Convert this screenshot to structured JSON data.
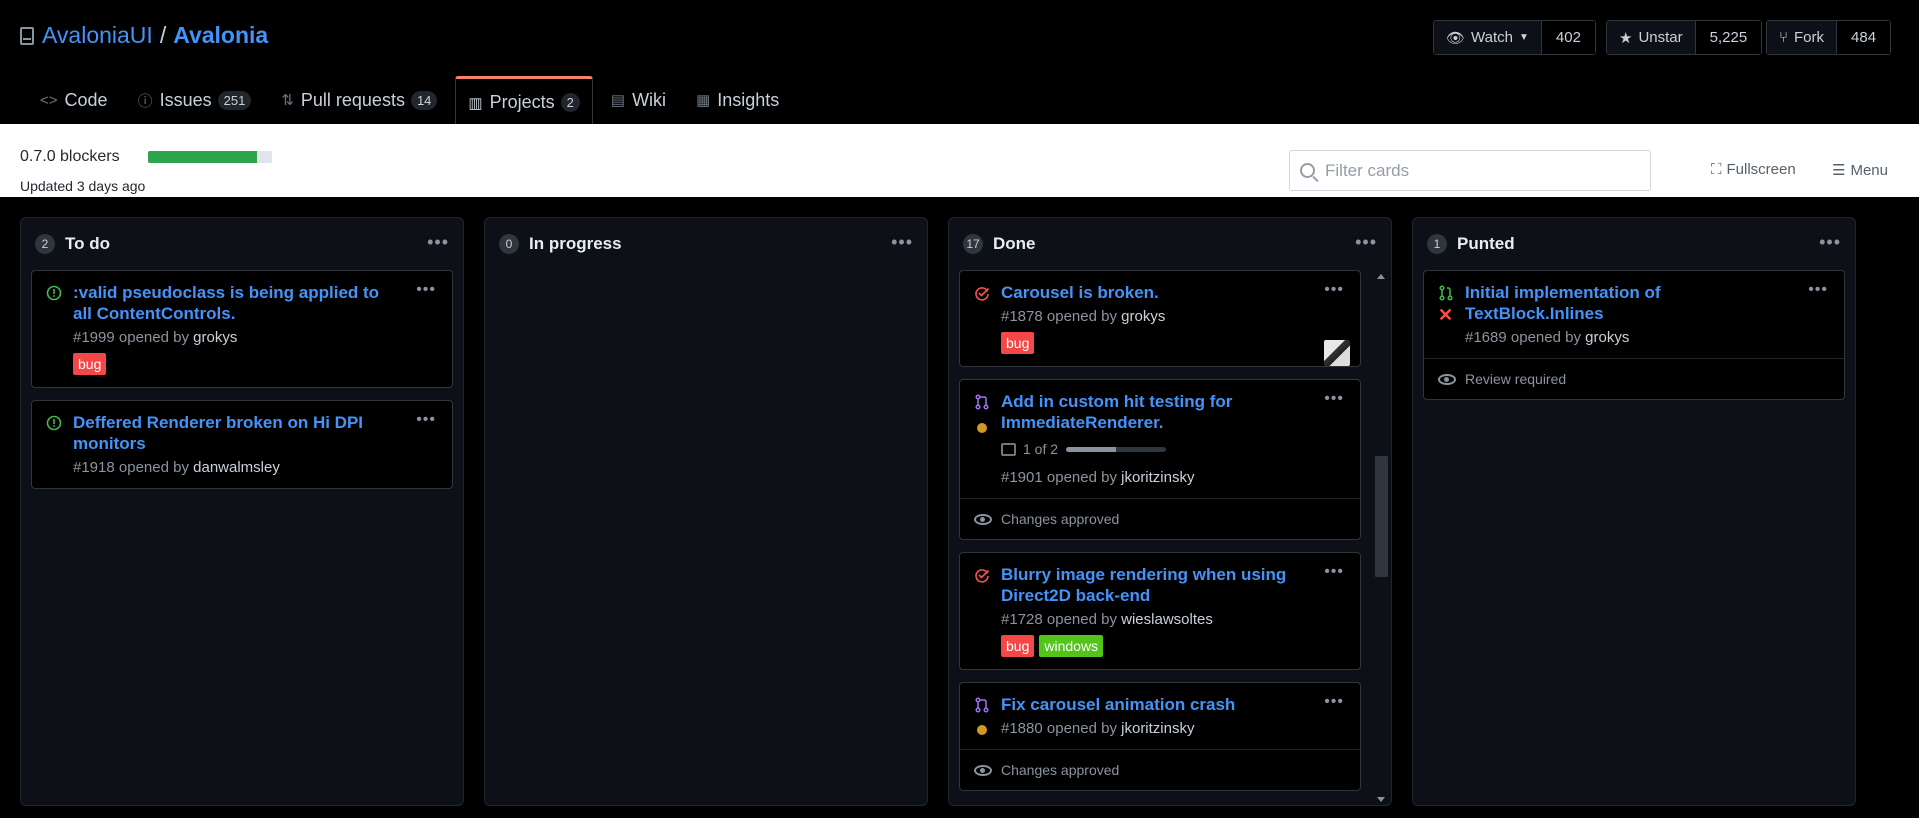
{
  "repo": {
    "owner": "AvaloniaUI",
    "separator": "/",
    "name": "Avalonia"
  },
  "actions": {
    "watch": {
      "label": "Watch",
      "count": "402"
    },
    "star": {
      "label": "Unstar",
      "count": "5,225"
    },
    "fork": {
      "label": "Fork",
      "count": "484"
    }
  },
  "tabs": [
    {
      "label": "Code",
      "count": ""
    },
    {
      "label": "Issues",
      "count": "251"
    },
    {
      "label": "Pull requests",
      "count": "14"
    },
    {
      "label": "Projects",
      "count": "2"
    },
    {
      "label": "Wiki",
      "count": ""
    },
    {
      "label": "Insights",
      "count": ""
    }
  ],
  "project": {
    "name": "0.7.0 blockers",
    "progress": 0.88,
    "updated": "Updated 3 days ago",
    "filter_placeholder": "Filter cards",
    "fullscreen_label": "Fullscreen",
    "menu_label": "Menu"
  },
  "columns": [
    {
      "title": "To do",
      "count": "2",
      "cards": [
        {
          "title": ":valid pseudoclass is being applied to all ContentControls.",
          "number": "#1999",
          "opened_by": "opened by",
          "author": "grokys",
          "labels": [
            {
              "name": "bug",
              "color": "#f44747"
            }
          ]
        },
        {
          "title": "Deffered Renderer broken on Hi DPI monitors",
          "number": "#1918",
          "opened_by": "opened by",
          "author": "danwalmsley",
          "labels": []
        }
      ]
    },
    {
      "title": "In progress",
      "count": "0",
      "cards": []
    },
    {
      "title": "Done",
      "count": "17",
      "cards": [
        {
          "title": "Carousel is broken.",
          "number": "#1878",
          "opened_by": "opened by",
          "author": "grokys",
          "labels": [
            {
              "name": "bug",
              "color": "#f44747"
            }
          ]
        },
        {
          "title": "Add in custom hit testing for ImmediateRenderer.",
          "number": "#1901",
          "opened_by": "opened by",
          "author": "jkoritzinsky",
          "tasks": "1 of 2",
          "tasks_done": 0.5,
          "review": "Changes approved"
        },
        {
          "title": "Blurry image rendering when using Direct2D back-end",
          "number": "#1728",
          "opened_by": "opened by",
          "author": "wieslawsoltes",
          "labels": [
            {
              "name": "bug",
              "color": "#f44747"
            },
            {
              "name": "windows",
              "color": "#52c41a"
            }
          ]
        },
        {
          "title": "Fix carousel animation crash",
          "number": "#1880",
          "opened_by": "opened by",
          "author": "jkoritzinsky",
          "review": "Changes approved"
        }
      ]
    },
    {
      "title": "Punted",
      "count": "1",
      "cards": [
        {
          "title": "Initial implementation of TextBlock.Inlines",
          "number": "#1689",
          "opened_by": "opened by",
          "author": "grokys",
          "review": "Review required"
        }
      ]
    }
  ],
  "colors": {
    "link": "#4493f8",
    "closed_issue": "#f85149",
    "merged_pr": "#a371f7",
    "open_issue": "#3fb950",
    "pending": "#d29922"
  }
}
